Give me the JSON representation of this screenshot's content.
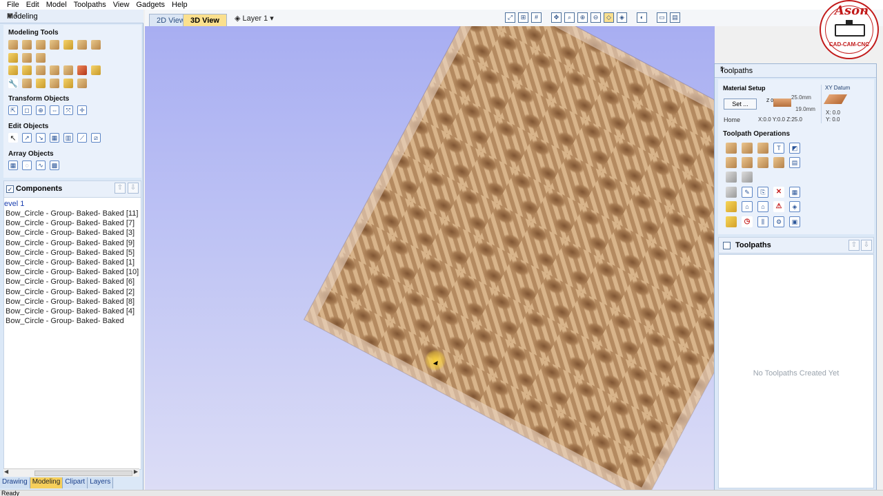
{
  "menu": [
    "File",
    "Edit",
    "Model",
    "Toolpaths",
    "View",
    "Gadgets",
    "Help"
  ],
  "left_panel": {
    "title": "Modeling",
    "sections": {
      "modeling_tools": "Modeling Tools",
      "transform_objects": "Transform Objects",
      "edit_objects": "Edit Objects",
      "array_objects": "Array Objects"
    },
    "components": {
      "label": "Components",
      "checked_mark": "✓",
      "level": "evel 1",
      "items": [
        "Bow_Circle - Group- Baked- Baked [11]",
        "Bow_Circle - Group- Baked- Baked [7]",
        "Bow_Circle - Group- Baked- Baked [3]",
        "Bow_Circle - Group- Baked- Baked [9]",
        "Bow_Circle - Group- Baked- Baked [5]",
        "Bow_Circle - Group- Baked- Baked [1]",
        "Bow_Circle - Group- Baked- Baked [10]",
        "Bow_Circle - Group- Baked- Baked [6]",
        "Bow_Circle - Group- Baked- Baked [2]",
        "Bow_Circle - Group- Baked- Baked [8]",
        "Bow_Circle - Group- Baked- Baked [4]",
        "Bow_Circle - Group- Baked- Baked"
      ]
    },
    "bottom_tabs": [
      "Drawing",
      "Modeling",
      "Clipart",
      "Layers"
    ],
    "active_tab": "Modeling"
  },
  "view_toolbar": {
    "tab_2d": "2D View",
    "tab_3d": "3D View",
    "layer": "Layer 1 ▾"
  },
  "right_panel": {
    "title": "Toolpaths",
    "material_setup": "Material Setup",
    "set_button": "Set ...",
    "home": "Home",
    "thickness": "25.0mm",
    "depth": "19.0mm",
    "z0": "Z 0",
    "home_position": "X:0.0 Y:0.0 Z:25.0",
    "xy_datum": "XY Datum",
    "xy_x": "X: 0.0",
    "xy_y": "Y: 0.0",
    "toolpath_operations": "Toolpath Operations",
    "toolpaths_list_label": "Toolpaths",
    "empty_message": "No Toolpaths Created Yet"
  },
  "status": "Ready",
  "logo": {
    "name": "Ason",
    "tagline": "CAD-CAM-CNC"
  },
  "colors": {
    "accent_tab": "#fbe08e",
    "panel_bg": "#dbe8f7",
    "viewport_top": "#a8aef2",
    "logo_red": "#c21a1a"
  }
}
